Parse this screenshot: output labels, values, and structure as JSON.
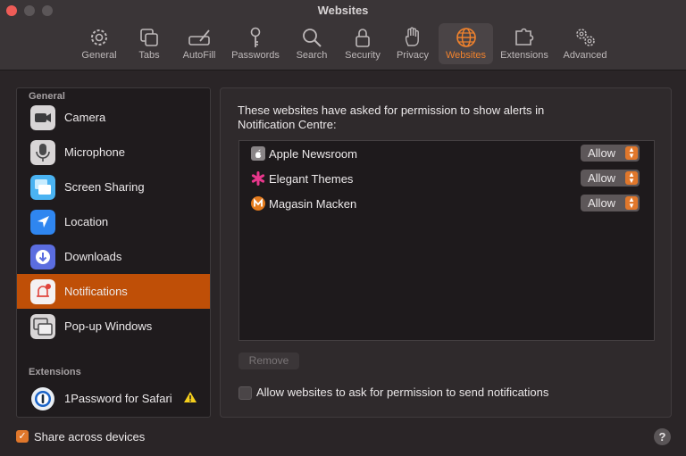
{
  "window": {
    "title": "Websites"
  },
  "toolbar": {
    "items": [
      {
        "label": "General",
        "icon": "gear-icon"
      },
      {
        "label": "Tabs",
        "icon": "tabs-icon"
      },
      {
        "label": "AutoFill",
        "icon": "autofill-icon"
      },
      {
        "label": "Passwords",
        "icon": "key-icon"
      },
      {
        "label": "Search",
        "icon": "search-icon"
      },
      {
        "label": "Security",
        "icon": "lock-icon"
      },
      {
        "label": "Privacy",
        "icon": "hand-icon"
      },
      {
        "label": "Websites",
        "icon": "globe-icon",
        "active": true
      },
      {
        "label": "Extensions",
        "icon": "puzzle-icon"
      },
      {
        "label": "Advanced",
        "icon": "gears-icon"
      }
    ]
  },
  "sidebar": {
    "general_header": "General",
    "items": [
      {
        "label": "Camera",
        "icon": "camera-icon"
      },
      {
        "label": "Microphone",
        "icon": "microphone-icon"
      },
      {
        "label": "Screen Sharing",
        "icon": "screen-sharing-icon"
      },
      {
        "label": "Location",
        "icon": "location-icon"
      },
      {
        "label": "Downloads",
        "icon": "download-icon"
      },
      {
        "label": "Notifications",
        "icon": "bell-icon",
        "selected": true
      },
      {
        "label": "Pop-up Windows",
        "icon": "popup-icon"
      }
    ],
    "extensions_header": "Extensions",
    "extensions": [
      {
        "label": "1Password for Safari",
        "icon": "onepassword-icon",
        "warning": true
      }
    ]
  },
  "content": {
    "prompt": "These websites have asked for permission to show alerts in Notification Centre:",
    "websites": [
      {
        "name": "Apple Newsroom",
        "permission": "Allow",
        "icon": "apple-icon"
      },
      {
        "name": "Elegant Themes",
        "permission": "Allow",
        "icon": "asterisk-icon"
      },
      {
        "name": "Magasin Macken",
        "permission": "Allow",
        "icon": "m-badge-icon"
      }
    ],
    "remove_label": "Remove",
    "allow_ask_label": "Allow websites to ask for permission to send notifications",
    "allow_ask_checked": false
  },
  "footer": {
    "share_label": "Share across devices",
    "share_checked": true,
    "help_label": "?"
  },
  "colors": {
    "accent": "#e0772b",
    "selection": "#bf4f07",
    "close": "#ee5c57"
  }
}
